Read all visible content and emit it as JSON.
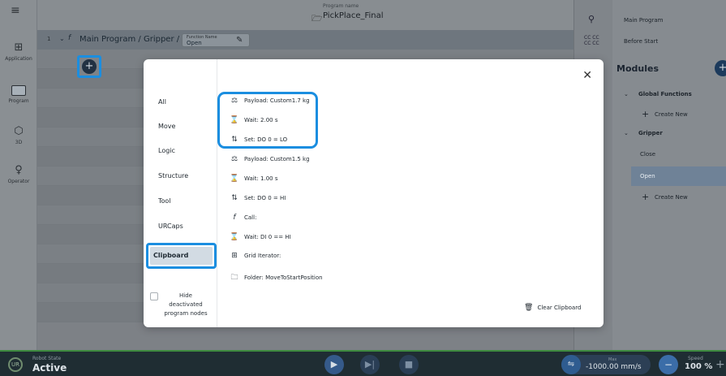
{
  "rail": {
    "items": [
      {
        "label": "Application",
        "icon": "grid-icon"
      },
      {
        "label": "Program",
        "icon": "monitor-icon"
      },
      {
        "label": "3D",
        "icon": "cube-icon"
      },
      {
        "label": "Operator",
        "icon": "person-icon"
      }
    ]
  },
  "header": {
    "caption": "Program name",
    "program_name": "PickPlace_Final"
  },
  "breadcrumb": {
    "line": "1",
    "path": "Main Program / Gripper /",
    "fn_caption": "Function Name",
    "fn_value": "Open"
  },
  "right": {
    "icon_top": "CC CC\nCC CC",
    "main_program": "Main Program",
    "before_start": "Before Start",
    "modules": "Modules",
    "global_functions": "Global Functions",
    "create_new": "Create New",
    "gripper": "Gripper",
    "close": "Close",
    "open": "Open",
    "create_new2": "Create New"
  },
  "modal": {
    "categories": [
      "All",
      "Move",
      "Logic",
      "Structure",
      "Tool",
      "URCaps",
      "Clipboard"
    ],
    "hide_label": "Hide deactivated program nodes",
    "items": [
      {
        "icon": "payload-icon",
        "label": "Payload: Custom1.7 kg"
      },
      {
        "icon": "hourglass-icon",
        "label": "Wait: 2.00 s"
      },
      {
        "icon": "set-icon",
        "label": "Set: DO 0 = LO"
      },
      {
        "icon": "payload-icon",
        "label": "Payload: Custom1.5 kg"
      },
      {
        "icon": "hourglass-icon",
        "label": "Wait: 1.00 s"
      },
      {
        "icon": "set-icon",
        "label": "Set: DO 0 = HI"
      },
      {
        "icon": "function-icon",
        "label": "Call:"
      },
      {
        "icon": "hourglass-icon",
        "label": "Wait: DI 0 == HI"
      },
      {
        "icon": "grid-icon",
        "label": "Grid Iterator:"
      },
      {
        "icon": "folder-icon",
        "label": "Folder: MoveToStartPosition"
      }
    ],
    "clear": "Clear Clipboard"
  },
  "bottom": {
    "robot_state_caption": "Robot State",
    "robot_state": "Active",
    "max_caption": "Max",
    "max_value": "-1000.00 mm/s",
    "speed_caption": "Speed",
    "speed_value": "100 %"
  }
}
